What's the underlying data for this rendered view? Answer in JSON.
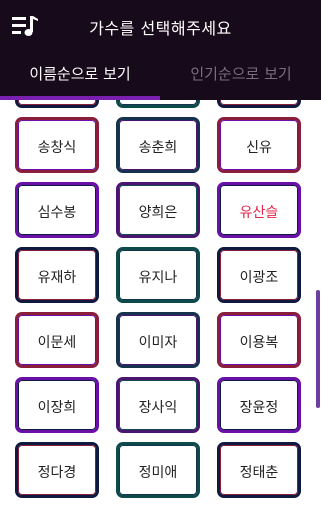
{
  "header": {
    "title": "가수를 선택해주세요"
  },
  "tabs": [
    {
      "label": "이름순으로 보기",
      "active": true
    },
    {
      "label": "인기순으로 보기",
      "active": false
    }
  ],
  "singers": [
    [
      "",
      "",
      ""
    ],
    [
      "송창식",
      "송춘희",
      "신유"
    ],
    [
      "심수봉",
      "양희은",
      "유산슬"
    ],
    [
      "유재하",
      "유지나",
      "이광조"
    ],
    [
      "이문세",
      "이미자",
      "이용복"
    ],
    [
      "이장희",
      "장사익",
      "장윤정"
    ],
    [
      "정다경",
      "정미애",
      "정태춘"
    ]
  ],
  "colors": {
    "header_bg": "#170a1a",
    "active_tab_text": "#ffffff",
    "inactive_tab_text": "#7a6d7d",
    "tab_indicator": "#7a1fb0",
    "highlight_name": "#e0284a",
    "cell_borders": [
      "#0e1a3f",
      "#4a1470",
      "#8a1e3a",
      "#0d4a4a",
      "#6a10a8",
      "#15334d"
    ]
  },
  "highlighted": "유산슬"
}
